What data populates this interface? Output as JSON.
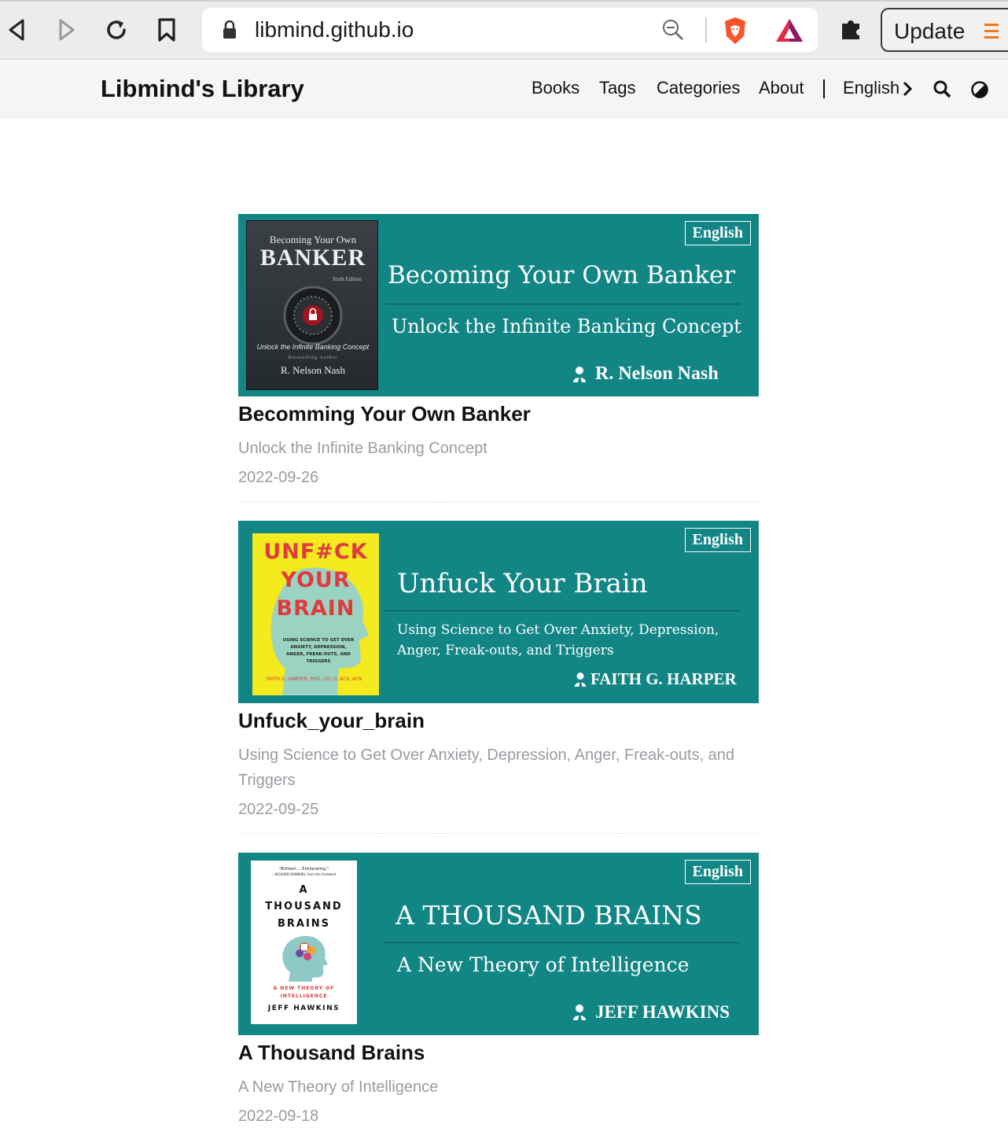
{
  "browser": {
    "url": "libmind.github.io",
    "update_label": "Update"
  },
  "site": {
    "title": "Libmind's Library",
    "nav": [
      "Books",
      "Tags",
      "Categories",
      "About"
    ],
    "language": "English"
  },
  "posts": [
    {
      "title": "Becomming Your Own Banker",
      "subtitle": "Unlock the Infinite Banking Concept",
      "date": "2022-09-26",
      "cover": {
        "language": "English",
        "title": "Becoming  Your Own Banker",
        "subtitle": "Unlock the Infinite Banking Concept",
        "author": "R. Nelson Nash",
        "book": {
          "top": "Becoming Your Own",
          "big": "BANKER",
          "edition": "Sixth Edition",
          "tag": "Unlock the Infinite Banking Concept",
          "small": "Bestselling Author",
          "author": "R. Nelson Nash"
        }
      }
    },
    {
      "title": "Unfuck_your_brain",
      "subtitle": "Using Science to Get Over Anxiety, Depression, Anger, Freak-outs, and Triggers",
      "date": "2022-09-25",
      "cover": {
        "language": "English",
        "title": "Unfuck Your Brain",
        "subtitle": "Using Science to Get Over Anxiety, Depression, Anger, Freak-outs, and Triggers",
        "author": "FAITH G. HARPER",
        "book": {
          "line1": "UNF#CK",
          "line2": "YOUR",
          "line3": "BRAIN",
          "tag": "USING SCIENCE TO GET OVER ANXIETY, DEPRESSION, ANGER, FREAK-OUTS, AND TRIGGERS",
          "author": "FAITH G. HARPER, PHD, LPC-S, ACS, ACN"
        }
      }
    },
    {
      "title": "A Thousand Brains",
      "subtitle": "A New Theory of Intelligence",
      "date": "2022-09-18",
      "cover": {
        "language": "English",
        "title": "A THOUSAND BRAINS",
        "subtitle": "A New Theory of Intelligence",
        "author": "JEFF HAWKINS",
        "book": {
          "quote": "\"Brilliant.... Exhilarating.\"",
          "quote_by": "—RICHARD DAWKINS, from the Foreword",
          "line1": "A",
          "line2": "THOUSAND",
          "line3": "BRAINS",
          "tag": "A NEW THEORY OF INTELLIGENCE",
          "author": "JEFF HAWKINS"
        }
      }
    }
  ],
  "colors": {
    "cover_bg": "#128585",
    "header_bg": "#f5f5f5",
    "meta_text": "#9a9aa2"
  }
}
